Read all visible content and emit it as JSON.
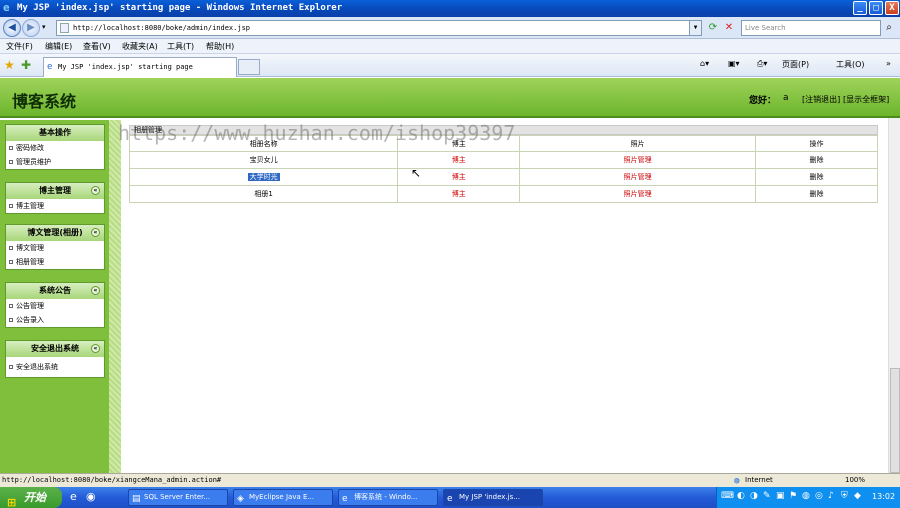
{
  "window": {
    "title": "My JSP 'index.jsp' starting page - Windows Internet Explorer",
    "buttons": [
      "_",
      "□",
      "X"
    ]
  },
  "address_bar": {
    "url": "http://localhost:8080/boke/admin/index.jsp",
    "search_placeholder": "Live Search"
  },
  "menu": [
    "文件(F)",
    "编辑(E)",
    "查看(V)",
    "收藏夹(A)",
    "工具(T)",
    "帮助(H)"
  ],
  "tab": {
    "label": "My JSP 'index.jsp' starting page"
  },
  "commands": {
    "home": "",
    "feeds": "",
    "print": "",
    "page": "页面(P)",
    "tools": "工具(O)"
  },
  "header": {
    "site_title": "博客系统",
    "greeting": "您好：",
    "username": "a",
    "logout": "[注销退出]",
    "show_frame": "[显示全框架]"
  },
  "sidebar": {
    "panels": [
      {
        "title": "基本操作",
        "items": [
          "密码修改",
          "管理员维护"
        ]
      },
      {
        "title": "博主管理",
        "items": [
          "博主管理"
        ]
      },
      {
        "title": "博文管理(相册)",
        "items": [
          "博文管理",
          "相册管理"
        ]
      },
      {
        "title": "系统公告",
        "items": [
          "公告管理",
          "公告录入"
        ]
      },
      {
        "title": "安全退出系统",
        "items": [
          "安全退出系统"
        ]
      }
    ]
  },
  "content": {
    "bar_title": "相册管理",
    "columns": [
      "相册名称",
      "博主",
      "照片",
      "操作"
    ],
    "rows": [
      {
        "name": "宝贝女儿",
        "owner": "博主",
        "photos": "照片管理",
        "action": "删除"
      },
      {
        "name": "大学时光",
        "owner": "博主",
        "photos": "照片管理",
        "action": "删除"
      },
      {
        "name": "相册1",
        "owner": "博主",
        "photos": "照片管理",
        "action": "删除"
      }
    ]
  },
  "status_bar": {
    "url": "http://localhost:8080/boke/xiangceMana_admin.action#",
    "zone": "Internet",
    "zoom": "100%"
  },
  "taskbar": {
    "start": "开始",
    "items": [
      "SQL Server Enter...",
      "MyEclipse Java E...",
      "博客系统 - Windo...",
      "My JSP 'index.js..."
    ],
    "clock": "13:02"
  },
  "watermark": "https://www.huzhan.com/ishop39397"
}
